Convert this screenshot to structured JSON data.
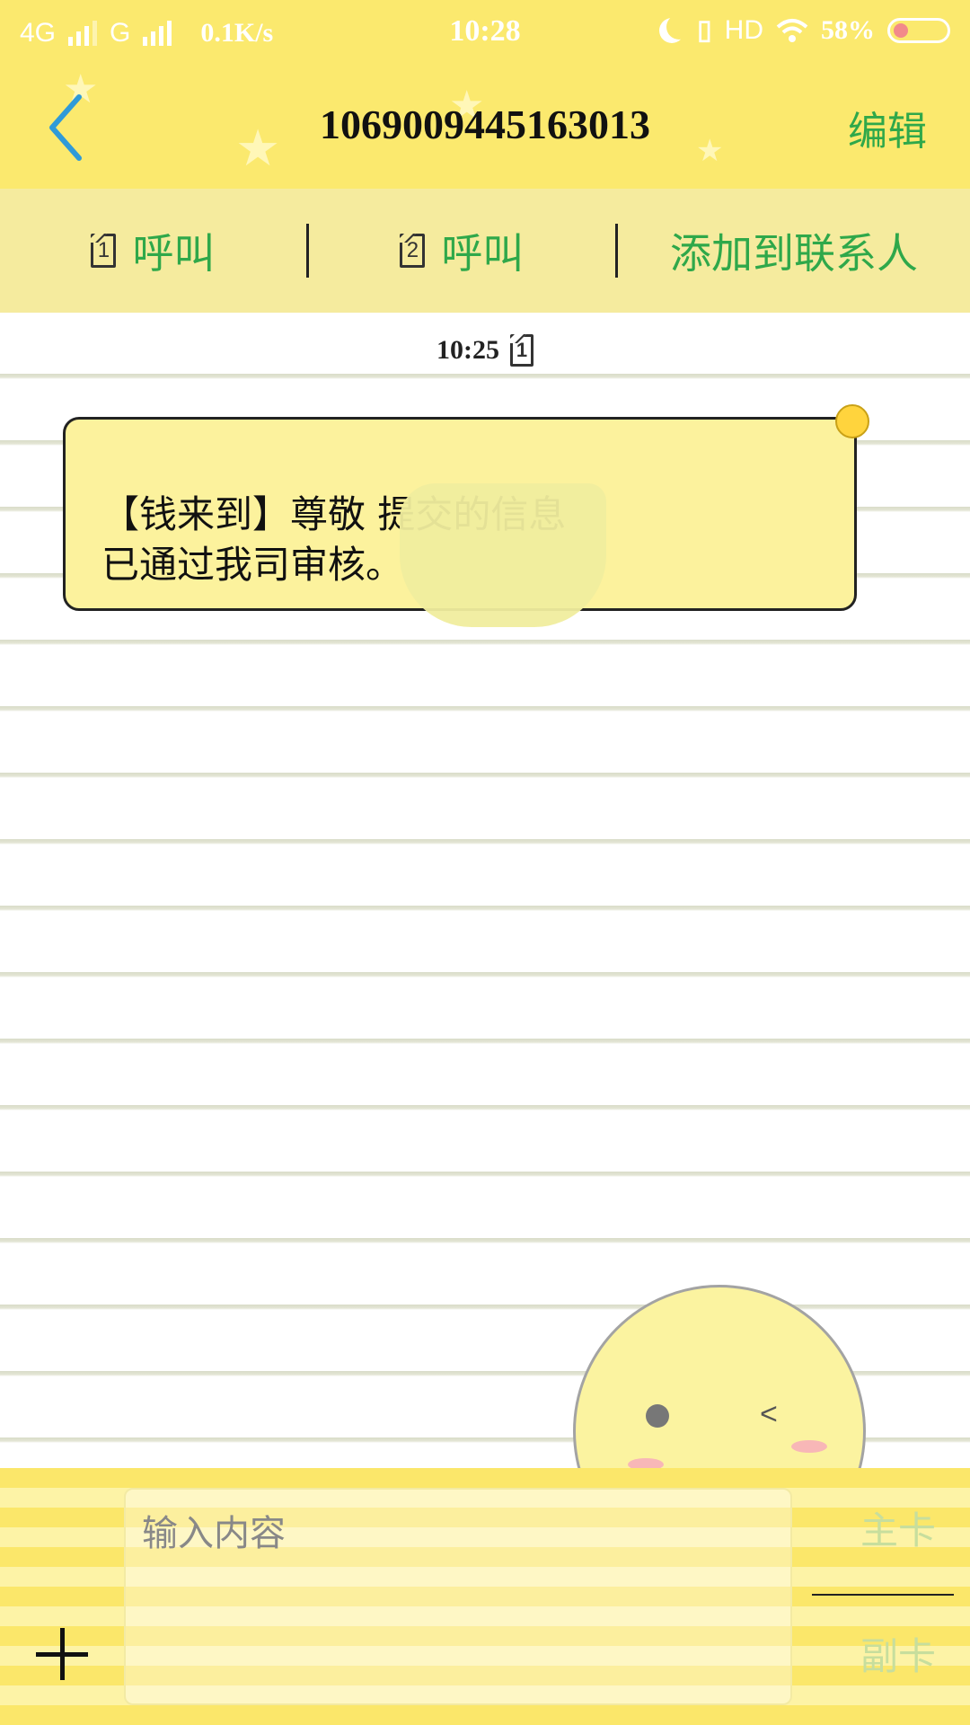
{
  "status_bar": {
    "network1": "4G",
    "network2": "G",
    "speed": "0.1K/s",
    "time": "10:28",
    "hd": "HD",
    "battery": "58%"
  },
  "header": {
    "title": "1069009445163013",
    "edit_label": "编辑"
  },
  "actions": [
    {
      "sim": "1",
      "label": "呼叫"
    },
    {
      "sim": "2",
      "label": "呼叫"
    },
    {
      "label": "添加到联系人"
    }
  ],
  "conversation": {
    "timestamp": "10:25",
    "timestamp_sim": "1",
    "message_line1": "【钱来到】尊敬                  提交的信息",
    "message_line2": "已通过我司审核。"
  },
  "composer": {
    "placeholder": "输入内容",
    "primary_sim": "主卡",
    "secondary_sim": "副卡"
  },
  "colors": {
    "header_bg": "#fbe96e",
    "accent_green": "#2fa84a",
    "bubble_bg": "#fcf29d"
  }
}
